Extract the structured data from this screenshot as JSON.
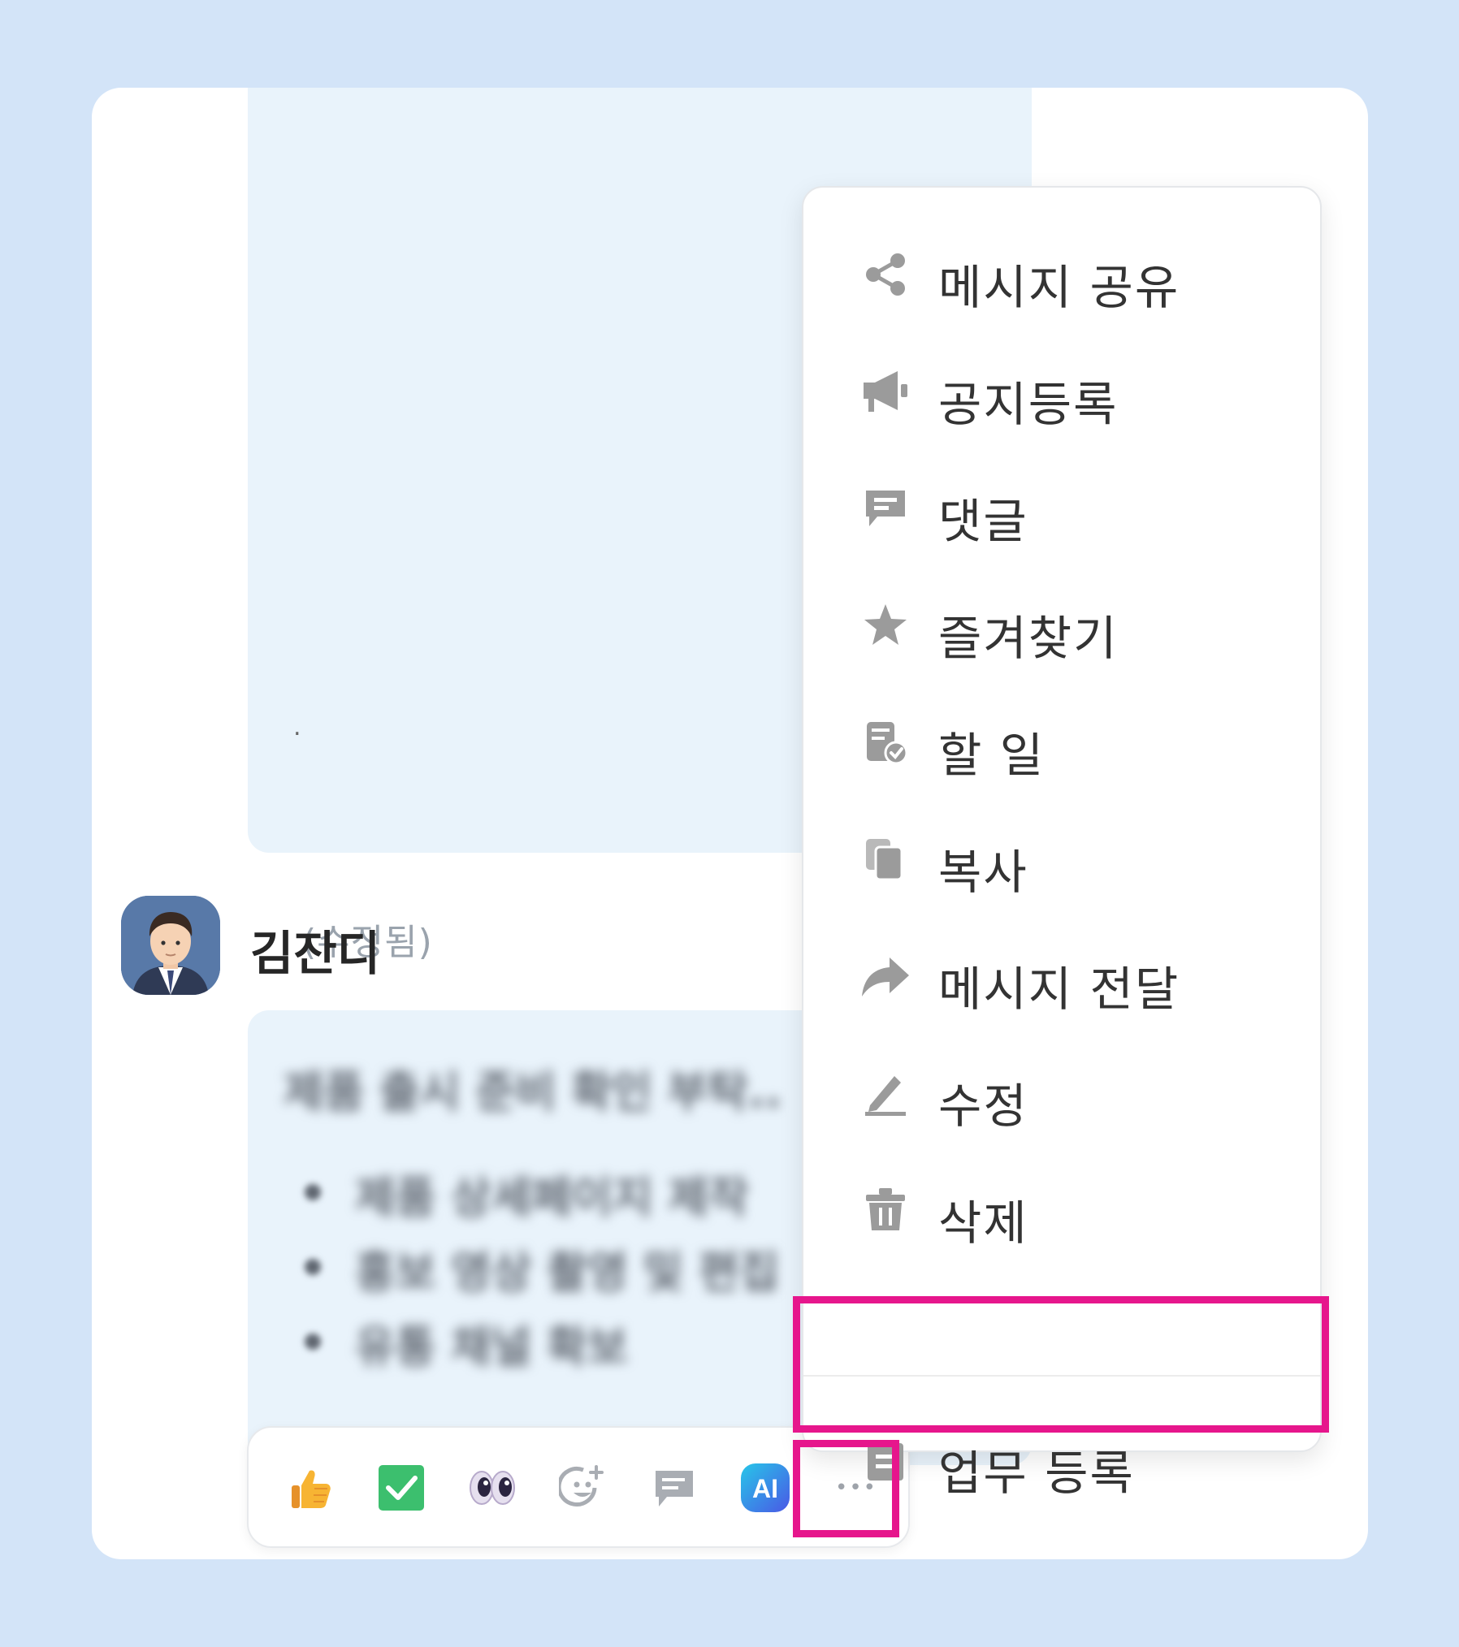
{
  "message_top": {
    "dot": ".",
    "edited_label": "(수정됨)"
  },
  "sender": {
    "name": "김잔디",
    "avatar_icon": "businessman-avatar-icon"
  },
  "message_bottom": {
    "blurred_title": "제품 출시 준비 확인 부탁..",
    "blurred_bullets": [
      "제품 상세페이지 제작",
      "홍보 영상 촬영 및 편집",
      "유통 채널 확보"
    ]
  },
  "reactions": [
    {
      "name": "thumbs-up-icon"
    },
    {
      "name": "check-box-icon"
    },
    {
      "name": "eyes-icon"
    },
    {
      "name": "add-emoji-icon"
    },
    {
      "name": "comment-icon"
    },
    {
      "name": "ai-icon",
      "text": "AI"
    },
    {
      "name": "more-icon",
      "text": "•••"
    }
  ],
  "context_menu": {
    "items": [
      {
        "label": "메시지 공유",
        "icon": "share-icon"
      },
      {
        "label": "공지등록",
        "icon": "megaphone-icon"
      },
      {
        "label": "댓글",
        "icon": "comment-icon"
      },
      {
        "label": "즐겨찾기",
        "icon": "star-icon"
      },
      {
        "label": "할 일",
        "icon": "todo-icon"
      },
      {
        "label": "복사",
        "icon": "copy-icon"
      },
      {
        "label": "메시지 전달",
        "icon": "forward-icon"
      },
      {
        "label": "수정",
        "icon": "edit-icon"
      },
      {
        "label": "삭제",
        "icon": "trash-icon"
      }
    ],
    "task_item": {
      "label": "업무 등록",
      "icon": "task-register-icon"
    }
  },
  "colors": {
    "background": "#d3e4f8",
    "bubble": "#e9f3fb",
    "highlight": "#e6168c",
    "icon_gray": "#9b9b9b"
  }
}
